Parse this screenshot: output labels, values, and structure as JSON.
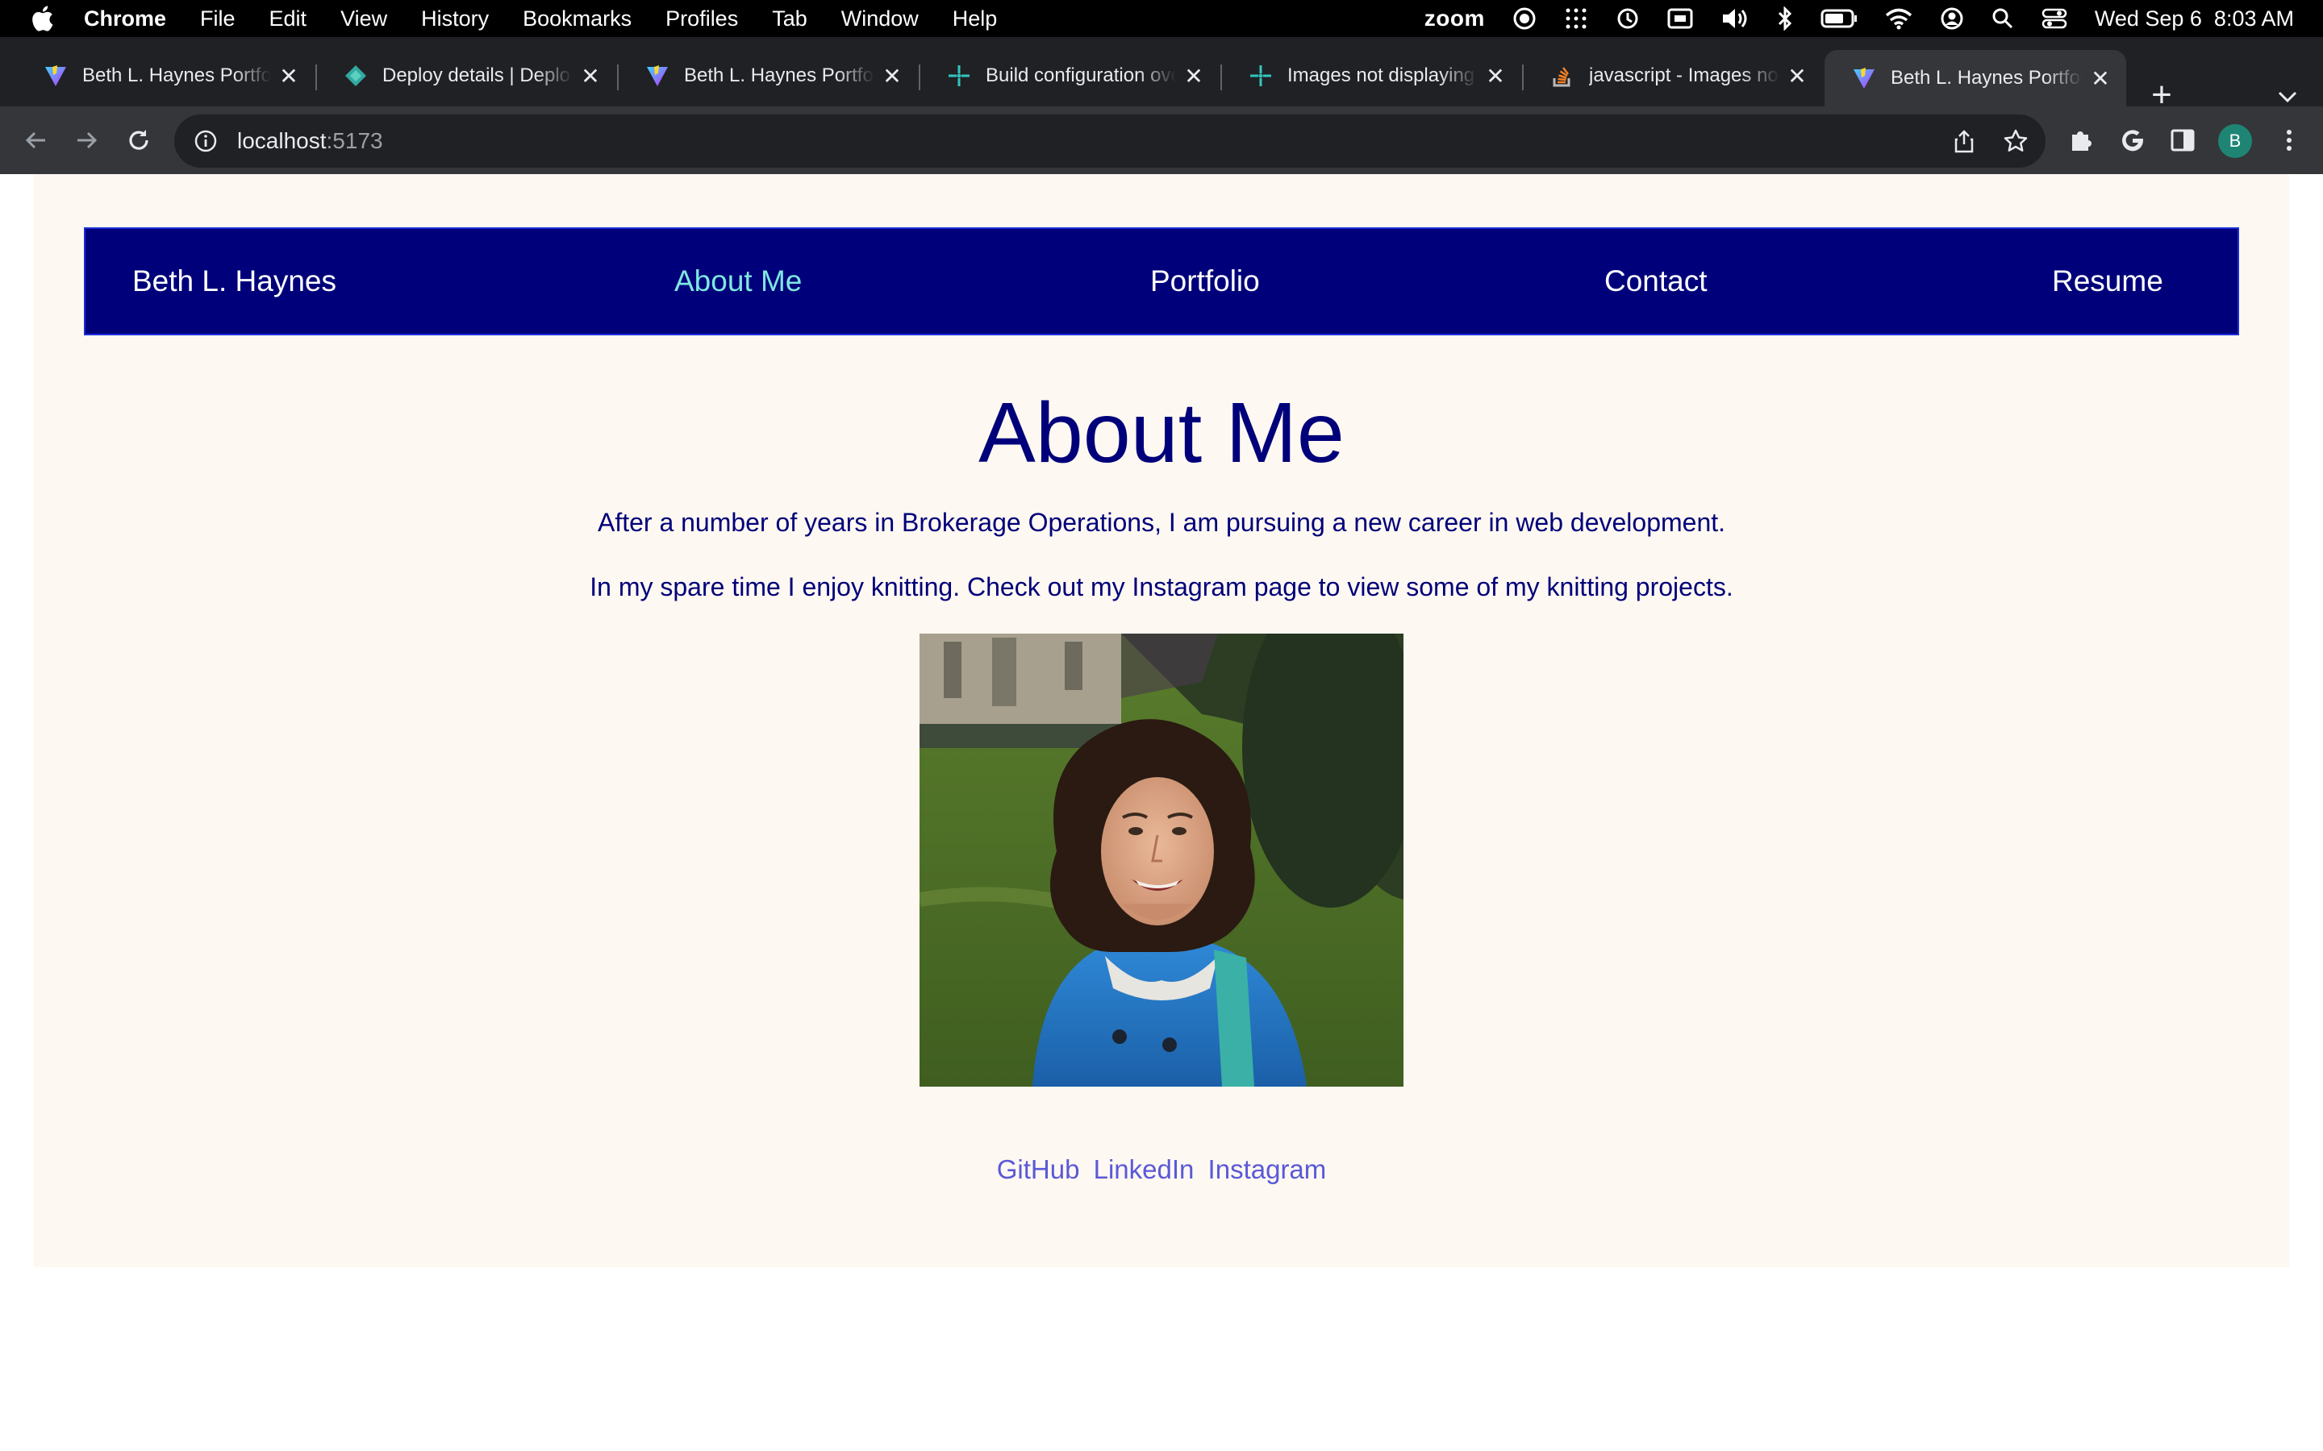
{
  "os_menubar": {
    "app": "Chrome",
    "items": [
      "File",
      "Edit",
      "View",
      "History",
      "Bookmarks",
      "Profiles",
      "Tab",
      "Window",
      "Help"
    ],
    "zoom_label": "zoom",
    "datetime": "Wed Sep 6  8:03 AM"
  },
  "tabs": [
    {
      "title": "Beth L. Haynes Portfolio",
      "icon": "vite-icon"
    },
    {
      "title": "Deploy details | Deploy",
      "icon": "netlify-icon"
    },
    {
      "title": "Beth L. Haynes Portfolio",
      "icon": "vite-icon"
    },
    {
      "title": "Build configuration overview",
      "icon": "netlify-icon"
    },
    {
      "title": "Images not displaying",
      "icon": "netlify-icon"
    },
    {
      "title": "javascript - Images not",
      "icon": "stackoverflow-icon"
    },
    {
      "title": "Beth L. Haynes Portfolio",
      "icon": "vite-icon"
    }
  ],
  "address_bar": {
    "host": "localhost",
    "port": ":5173"
  },
  "profile_initial": "B",
  "site": {
    "nav": {
      "brand": "Beth L. Haynes",
      "links": [
        "About Me",
        "Portfolio",
        "Contact",
        "Resume"
      ],
      "active": "About Me"
    },
    "heading": "About Me",
    "paragraphs": [
      "After a number of years in Brokerage Operations, I am pursuing a new career in web development.",
      "In my spare time I enjoy knitting. Check out my Instagram page to view some of my knitting projects."
    ],
    "footer_links": [
      "GitHub",
      "LinkedIn",
      "Instagram"
    ]
  },
  "colors": {
    "nav_bg": "#00007a",
    "active_link": "#7fe6e0",
    "page_bg": "#fdf8f1",
    "text": "#00007a",
    "footer_link": "#5a59d8"
  }
}
